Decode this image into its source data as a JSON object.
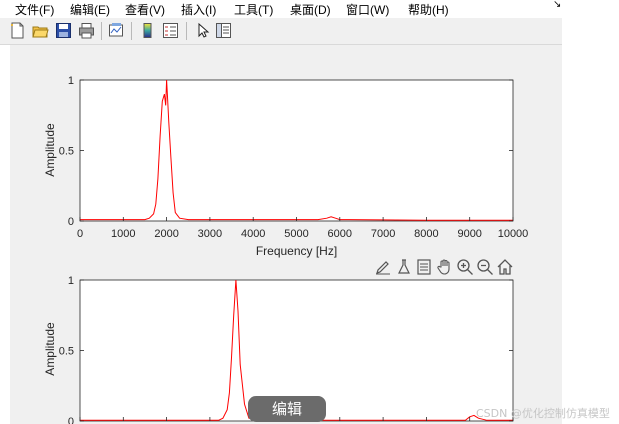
{
  "menubar": {
    "items": [
      "文件(F)",
      "编辑(E)",
      "查看(V)",
      "插入(I)",
      "工具(T)",
      "桌面(D)",
      "窗口(W)",
      "帮助(H)"
    ],
    "corner_glyph": "↘"
  },
  "toolbar": {
    "icons": [
      "new-figure-icon",
      "open-file-icon",
      "save-icon",
      "print-icon",
      "link-plot-icon",
      "colorbar-icon",
      "legend-icon",
      "edit-plot-arrow-icon",
      "property-inspector-icon"
    ]
  },
  "axes_toolbar": {
    "icons": [
      "brush-icon",
      "data-tips-icon",
      "datacursor-icon",
      "pan-hand-icon",
      "zoom-in-icon",
      "zoom-out-icon",
      "home-icon"
    ]
  },
  "chart_data": [
    {
      "type": "line",
      "xlabel": "Frequency [Hz]",
      "ylabel": "Amplitude",
      "xlim": [
        0,
        10000
      ],
      "ylim": [
        0,
        1
      ],
      "xticks": [
        "0",
        "1000",
        "2000",
        "3000",
        "4000",
        "5000",
        "6000",
        "7000",
        "8000",
        "9000",
        "10000"
      ],
      "yticks": [
        "0",
        "0.5",
        "1"
      ],
      "series_color": "#ff0000",
      "x": [
        0,
        1500,
        1600,
        1700,
        1750,
        1800,
        1850,
        1900,
        1950,
        1980,
        2000,
        2020,
        2050,
        2100,
        2150,
        2200,
        2300,
        2500,
        3000,
        5500,
        5700,
        5800,
        5900,
        6000,
        6200,
        8000,
        10000
      ],
      "y": [
        0.01,
        0.01,
        0.02,
        0.05,
        0.12,
        0.3,
        0.6,
        0.85,
        0.9,
        0.82,
        1.0,
        0.88,
        0.7,
        0.45,
        0.2,
        0.06,
        0.02,
        0.01,
        0.01,
        0.01,
        0.02,
        0.03,
        0.02,
        0.01,
        0.01,
        0.005,
        0.005
      ]
    },
    {
      "type": "line",
      "xlabel": "",
      "ylabel": "Amplitude",
      "xlim": [
        0,
        10000
      ],
      "ylim": [
        0,
        1
      ],
      "xticks": [],
      "yticks": [
        "0",
        "0.5",
        "1"
      ],
      "series_color": "#ff0000",
      "x": [
        0,
        3200,
        3300,
        3400,
        3450,
        3500,
        3550,
        3600,
        3650,
        3700,
        3800,
        3900,
        4200,
        8900,
        9000,
        9100,
        9200,
        9400,
        10000
      ],
      "y": [
        0.005,
        0.005,
        0.02,
        0.08,
        0.2,
        0.45,
        0.75,
        1.0,
        0.78,
        0.4,
        0.12,
        0.02,
        0.005,
        0.005,
        0.03,
        0.04,
        0.02,
        0.005,
        0.005
      ]
    }
  ],
  "overlay": {
    "edit_button": "编辑",
    "watermark": "CSDN @优化控制仿真模型"
  }
}
